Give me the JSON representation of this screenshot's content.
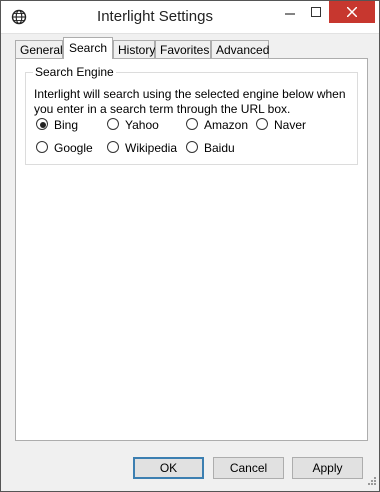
{
  "window": {
    "title": "Interlight Settings"
  },
  "tabs": [
    {
      "label": "General"
    },
    {
      "label": "Search"
    },
    {
      "label": "History"
    },
    {
      "label": "Favorites"
    },
    {
      "label": "Advanced"
    }
  ],
  "search_engine": {
    "legend": "Search Engine",
    "description": "Interlight will search using the selected engine below when you enter in a search term through the URL box.",
    "options": [
      {
        "label": "Bing",
        "selected": true
      },
      {
        "label": "Yahoo",
        "selected": false
      },
      {
        "label": "Amazon",
        "selected": false
      },
      {
        "label": "Naver",
        "selected": false
      },
      {
        "label": "Google",
        "selected": false
      },
      {
        "label": "Wikipedia",
        "selected": false
      },
      {
        "label": "Baidu",
        "selected": false
      }
    ]
  },
  "buttons": {
    "ok": "OK",
    "cancel": "Cancel",
    "apply": "Apply"
  },
  "colors": {
    "close_button": "#c7372f",
    "dialog_bg": "#f0f0f0",
    "panel_bg": "#ffffff"
  }
}
